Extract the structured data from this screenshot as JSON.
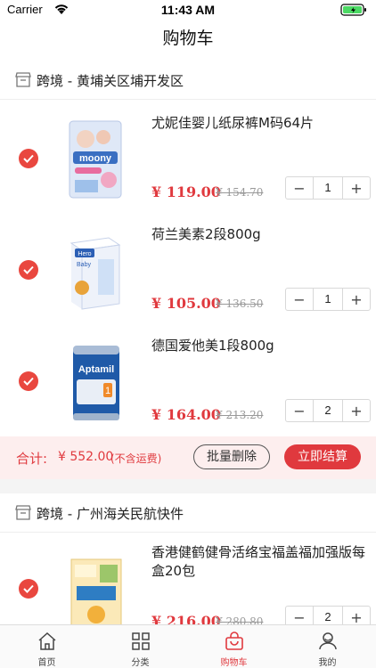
{
  "status": {
    "carrier": "Carrier",
    "time": "11:43 AM"
  },
  "nav": {
    "title": "购物车"
  },
  "stores": [
    {
      "name": "跨境 - 黄埔关区埔开发区"
    },
    {
      "name": "跨境 - 广州海关民航快件"
    }
  ],
  "items": [
    {
      "title": "尤妮佳婴儿纸尿裤M码64片",
      "price": "¥ 119.00",
      "old_price": "¥ 154.70",
      "qty": "1",
      "minus": "−",
      "plus": "+",
      "image": "moony-diaper-pack"
    },
    {
      "title": "荷兰美素2段800g",
      "price": "¥ 105.00",
      "old_price": "¥ 136.50",
      "qty": "1",
      "minus": "−",
      "plus": "+",
      "image": "hero-baby-formula-box"
    },
    {
      "title": "德国爱他美1段800g",
      "price": "¥ 164.00",
      "old_price": "¥ 213.20",
      "qty": "2",
      "minus": "−",
      "plus": "+",
      "image": "aptamil-formula-can"
    },
    {
      "title": "香港健鹤健骨活络宝福盖福加强版每盒20包",
      "price": "¥ 216.00",
      "old_price": "¥ 280.80",
      "qty": "2",
      "minus": "−",
      "plus": "+",
      "image": "supplement-box"
    }
  ],
  "summary": {
    "label": "合计:",
    "total": "¥ 552.00",
    "note": "(不含运费)",
    "batch_delete": "批量删除",
    "checkout": "立即结算"
  },
  "tabs": [
    {
      "label": "首页",
      "icon": "home-icon"
    },
    {
      "label": "分类",
      "icon": "grid-icon"
    },
    {
      "label": "购物车",
      "icon": "bag-icon",
      "active": true
    },
    {
      "label": "我的",
      "icon": "user-icon"
    }
  ],
  "colors": {
    "accent": "#e0393e",
    "summary_bg": "#fdeeee",
    "divider": "#f4f4f4"
  }
}
